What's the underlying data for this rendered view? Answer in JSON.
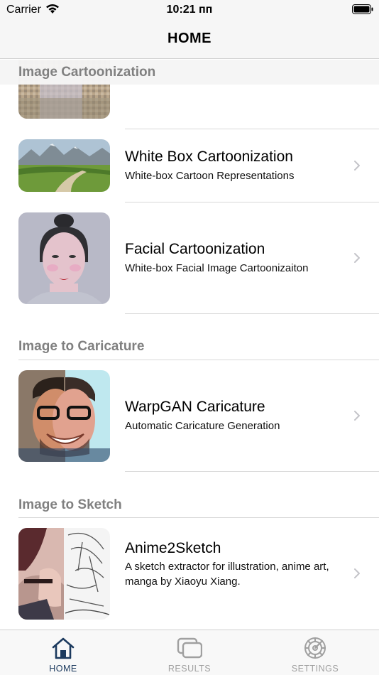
{
  "status_bar": {
    "carrier": "Carrier",
    "time": "10:21 пп"
  },
  "nav": {
    "title": "HOME"
  },
  "sections": {
    "cartoonization": {
      "header": "Image Cartoonization"
    },
    "caricature": {
      "header": "Image to Caricature"
    },
    "sketch": {
      "header": "Image to Sketch"
    }
  },
  "rows": {
    "white_box": {
      "title": "White Box Cartoonization",
      "subtitle": "White-box Cartoon Representations"
    },
    "facial": {
      "title": "Facial Cartoonization",
      "subtitle": "White-box Facial Image Cartoonizaiton"
    },
    "warpgan": {
      "title": "WarpGAN Caricature",
      "subtitle": "Automatic Caricature Generation"
    },
    "anime2sketch": {
      "title": "Anime2Sketch",
      "subtitle": "A sketch extractor for illustration, anime art, manga by Xiaoyu Xiang."
    }
  },
  "tabs": [
    {
      "label": "HOME",
      "icon": "house-icon",
      "active": true
    },
    {
      "label": "RESULTS",
      "icon": "stacked-images-icon",
      "active": false
    },
    {
      "label": "SETTINGS",
      "icon": "gear-icon",
      "active": false
    }
  ],
  "colors": {
    "accent": "#1c3a5e",
    "inactive": "#a0a0a0",
    "section_text": "#808080",
    "chevron": "#c4c4c9"
  }
}
